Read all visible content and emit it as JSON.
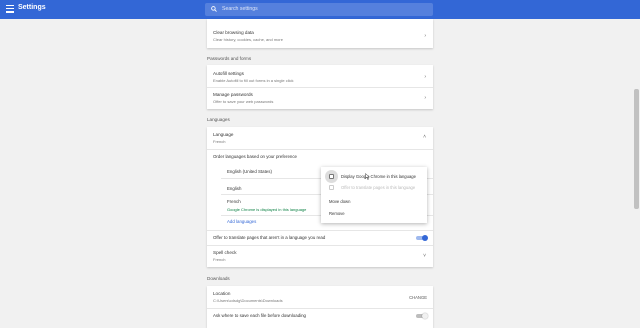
{
  "header": {
    "title": "Settings",
    "search_placeholder": "Search settings"
  },
  "privacy": {
    "clear_browsing": {
      "label": "Clear browsing data",
      "desc": "Clear history, cookies, cache, and more"
    }
  },
  "passwords": {
    "section_title": "Passwords and forms",
    "autofill": {
      "label": "Autofill settings",
      "desc": "Enable Autofill to fill out forms in a single click"
    },
    "manage": {
      "label": "Manage passwords",
      "desc": "Offer to save your web passwords"
    }
  },
  "languages": {
    "section_title": "Languages",
    "language": {
      "label": "Language",
      "value": "French"
    },
    "order_label": "Order languages based on your preference",
    "items": [
      {
        "name": "English (United States)"
      },
      {
        "name": "English"
      },
      {
        "name": "French",
        "note": "Google Chrome is displayed in this language"
      }
    ],
    "add_languages": "Add languages",
    "offer_translate": "Offer to translate pages that aren't in a language you read",
    "spell_check": {
      "label": "Spell check",
      "value": "French"
    }
  },
  "context_menu": {
    "display_chrome": "Display Google Chrome in this language",
    "offer_translate": "Offer to translate pages in this language",
    "move_down": "Move down",
    "remove": "Remove"
  },
  "downloads": {
    "section_title": "Downloads",
    "location": {
      "label": "Location",
      "value": "C:\\Users\\cdsdg\\Documents\\Downloads",
      "change": "CHANGE"
    },
    "ask": "Ask where to save each file before downloading"
  },
  "colors": {
    "accent": "#3367d6",
    "green": "#0b8043"
  },
  "toggles": {
    "offer_translate": true,
    "ask_where": false
  }
}
